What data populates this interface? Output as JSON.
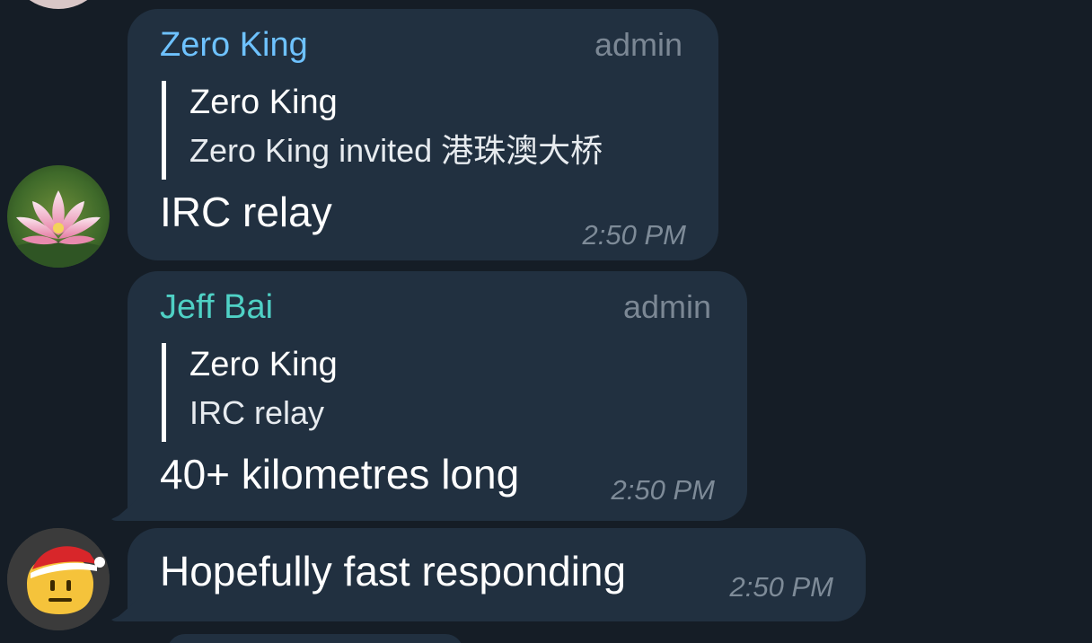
{
  "colors": {
    "background": "#151d26",
    "bubble": "#213040",
    "zero_king_name": "#6ec2ff",
    "jeff_bai_name": "#4fd1c5",
    "meta": "#7e8b98",
    "text": "#ffffff"
  },
  "messages": [
    {
      "sender": "Zero King",
      "role": "admin",
      "reply": {
        "author": "Zero King",
        "text": "Zero King invited 港珠澳大桥"
      },
      "text": "IRC relay",
      "time": "2:50 PM",
      "avatar": "lotus-flower-avatar"
    },
    {
      "sender": "Jeff Bai",
      "role": "admin",
      "reply": {
        "author": "Zero King",
        "text": "IRC relay"
      },
      "text": "40+ kilometres long",
      "time": "2:50 PM"
    },
    {
      "text": "Hopefully fast responding",
      "time": "2:50 PM",
      "avatar": "santa-hat-emoji-avatar"
    }
  ]
}
